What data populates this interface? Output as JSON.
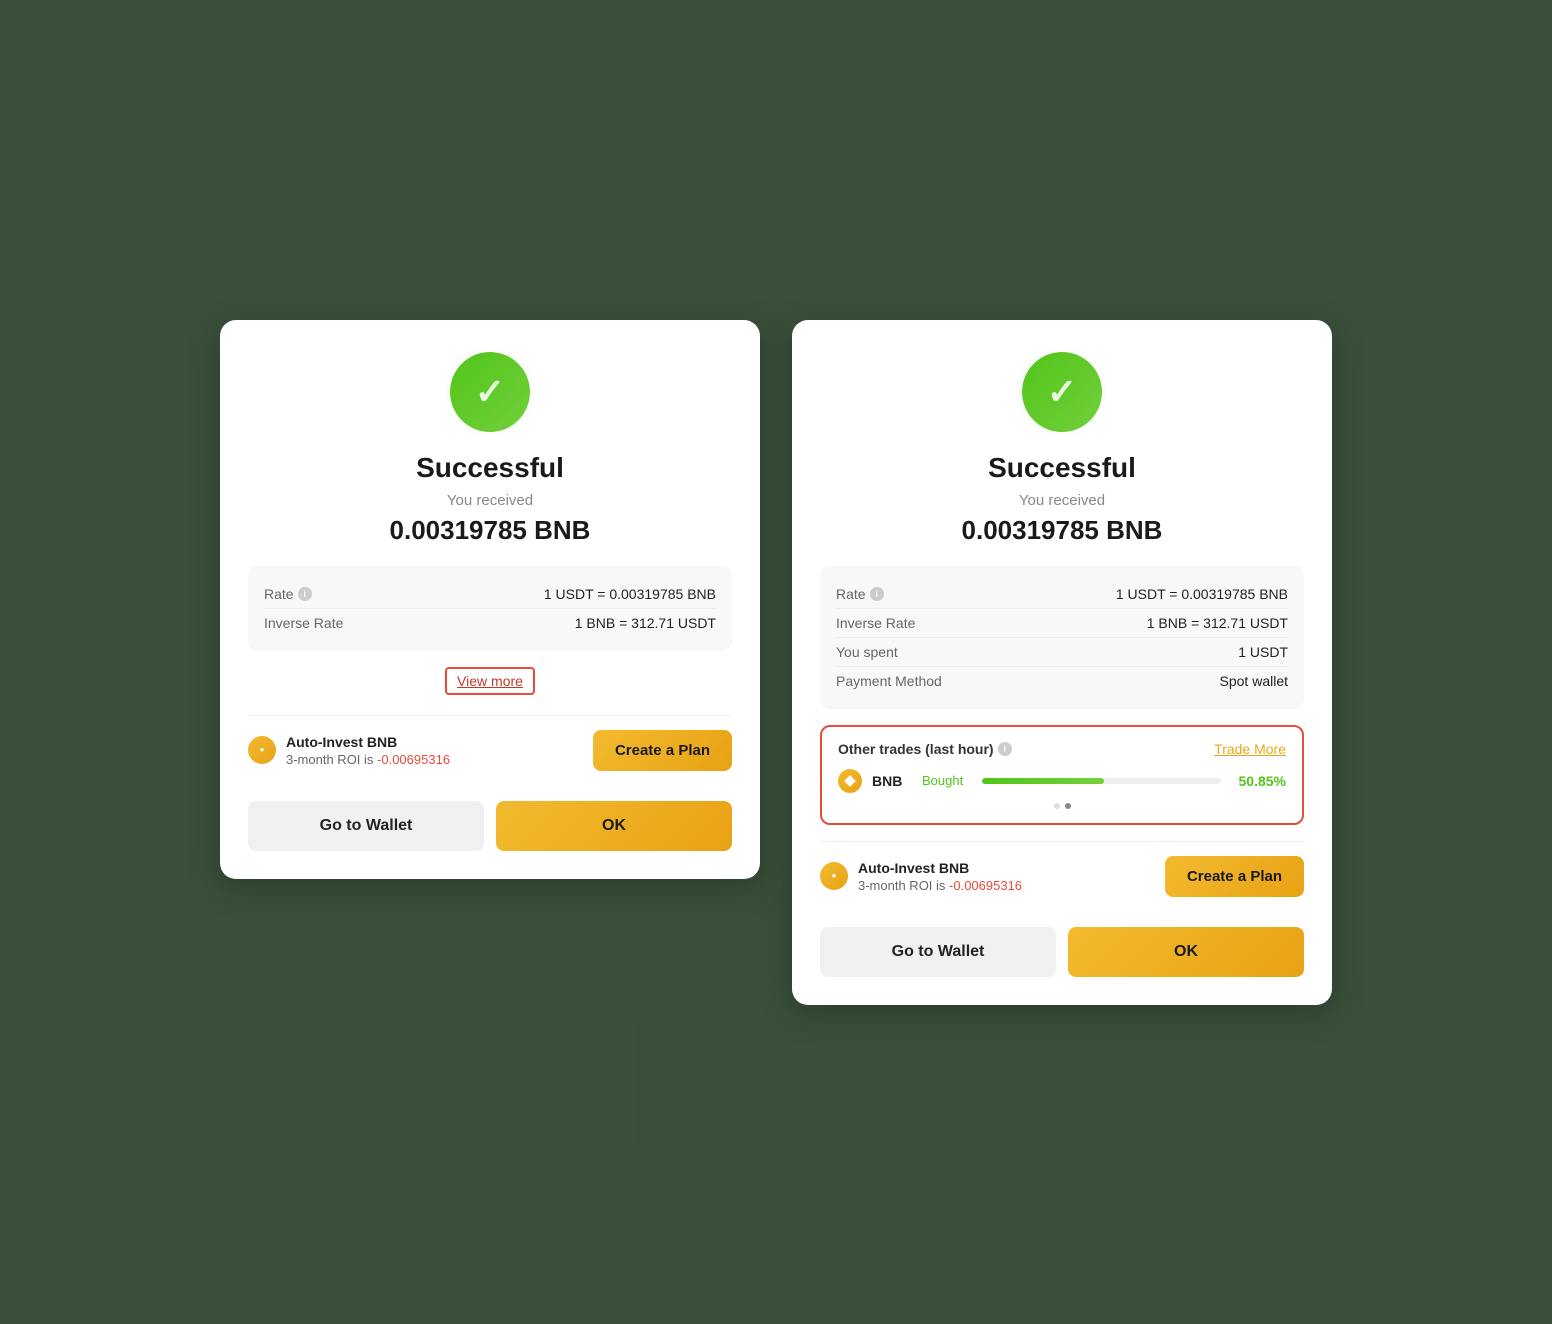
{
  "background": {
    "color": "#5a7a5a"
  },
  "dialog_left": {
    "title": "Successful",
    "received_label": "You received",
    "received_amount": "0.00319785 BNB",
    "details": [
      {
        "label": "Rate",
        "value": "1 USDT = 0.00319785 BNB",
        "has_info": true
      },
      {
        "label": "Inverse Rate",
        "value": "1 BNB = 312.71 USDT",
        "has_info": false
      }
    ],
    "view_more_label": "View more",
    "auto_invest": {
      "coin": "BNB",
      "title": "Auto-Invest BNB",
      "roi_label": "3-month ROI is ",
      "roi_value": "-0.00695316",
      "create_plan_label": "Create a Plan"
    },
    "go_to_wallet_label": "Go to Wallet",
    "ok_label": "OK"
  },
  "dialog_right": {
    "title": "Successful",
    "received_label": "You received",
    "received_amount": "0.00319785 BNB",
    "details": [
      {
        "label": "Rate",
        "value": "1 USDT = 0.00319785 BNB",
        "has_info": true
      },
      {
        "label": "Inverse Rate",
        "value": "1 BNB = 312.71 USDT",
        "has_info": false
      },
      {
        "label": "You spent",
        "value": "1 USDT",
        "has_info": false
      },
      {
        "label": "Payment Method",
        "value": "Spot wallet",
        "has_info": false
      }
    ],
    "other_trades": {
      "label": "Other trades (last hour)",
      "has_info": true,
      "trade_more_label": "Trade More",
      "items": [
        {
          "coin": "BNB",
          "action": "Bought",
          "progress": 50.85,
          "percent": "50.85%"
        }
      ],
      "dots": [
        false,
        true
      ]
    },
    "auto_invest": {
      "coin": "BNB",
      "title": "Auto-Invest BNB",
      "roi_label": "3-month ROI is ",
      "roi_value": "-0.00695316",
      "create_plan_label": "Create a Plan"
    },
    "go_to_wallet_label": "Go to Wallet",
    "ok_label": "OK"
  },
  "icons": {
    "info": "i",
    "checkmark": "✓"
  }
}
